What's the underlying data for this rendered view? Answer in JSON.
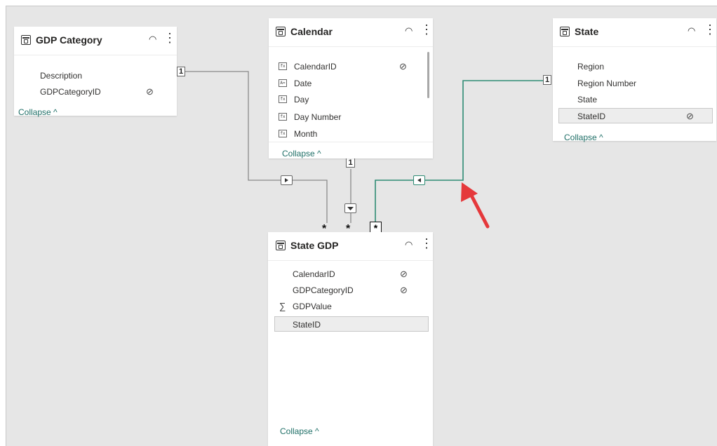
{
  "tables": {
    "gdp_category": {
      "title": "GDP Category",
      "fields": [
        {
          "label": "Description"
        },
        {
          "label": "GDPCategoryID",
          "hidden": true
        }
      ],
      "collapse": "Collapse ^"
    },
    "calendar": {
      "title": "Calendar",
      "fields": [
        {
          "label": "CalendarID",
          "icon": "calc-column-icon",
          "hidden": true
        },
        {
          "label": "Date",
          "icon": "text-column-icon"
        },
        {
          "label": "Day",
          "icon": "calc-column-icon"
        },
        {
          "label": "Day Number",
          "icon": "calc-column-icon"
        },
        {
          "label": "Month",
          "icon": "calc-column-icon"
        }
      ],
      "collapse": "Collapse ^"
    },
    "state": {
      "title": "State",
      "fields": [
        {
          "label": "Region"
        },
        {
          "label": "Region Number"
        },
        {
          "label": "State"
        },
        {
          "label": "StateID",
          "hidden": true,
          "selected": true
        }
      ],
      "collapse": "Collapse ^"
    },
    "state_gdp": {
      "title": "State GDP",
      "fields": [
        {
          "label": "CalendarID",
          "hidden": true
        },
        {
          "label": "GDPCategoryID",
          "hidden": true
        },
        {
          "label": "GDPValue",
          "icon": "sigma-icon"
        },
        {
          "label": "StateID",
          "selected": true
        }
      ],
      "collapse": "Collapse ^"
    }
  },
  "relationships": {
    "one_label": "1",
    "many_label": "*"
  },
  "colors": {
    "canvas": "#e6e6e6",
    "line_default": "#8a8a8a",
    "line_highlight": "#2e8b74",
    "annotation_arrow": "#e5383b",
    "collapse_text": "#1f6f67"
  }
}
